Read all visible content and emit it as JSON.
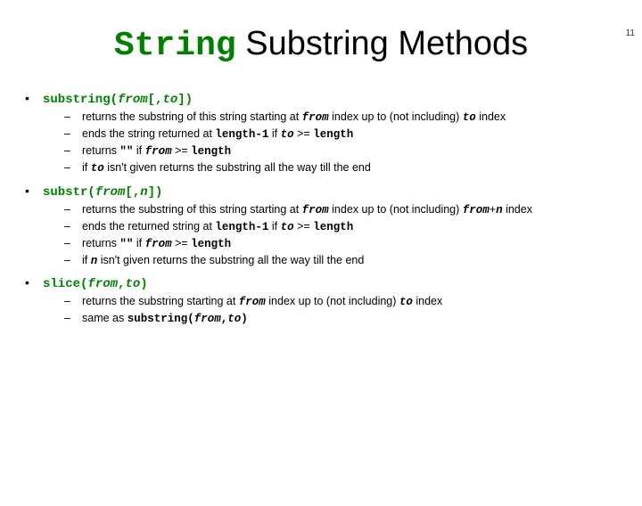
{
  "page_number": "11",
  "title": {
    "code_part": "String",
    "rest": " Substring Methods"
  },
  "methods": [
    {
      "sig_html": "substring(<span class='arg'>from</span>[,<span class='arg'>to</span>])",
      "items": [
        "returns the substring of this string starting at <span class='ci'>from</span> index up to (not including) <span class='ci'>to</span> index",
        "ends the string returned at <span class='c'>length-1</span> if <span class='ci'>to</span> &gt;= <span class='c'>length</span>",
        "returns <span class='c'>\"\"</span> if <span class='ci'>from</span> &gt;= <span class='c'>length</span>",
        "if <span class='ci'>to</span> isn't given returns the substring all the way till the end"
      ]
    },
    {
      "sig_html": "substr(<span class='arg'>from</span>[,<span class='arg'>n</span>])",
      "items": [
        "returns the substring of this string starting at <span class='ci'>from</span> index up to (not including) <span class='ci'>from</span>+<span class='ci'>n</span> index",
        "ends the returned string at <span class='c'>length-1</span> if <span class='ci'>to</span> &gt;= <span class='c'>length</span>",
        "returns <span class='c'>\"\"</span> if <span class='ci'>from</span> &gt;= <span class='c'>length</span>",
        "if <span class='ci'>n</span> isn't given returns the substring all the way till the end"
      ]
    },
    {
      "sig_html": "slice(<span class='arg'>from</span>,<span class='arg'>to</span>)",
      "items": [
        "returns the substring starting at <span class='ci'>from</span> index up to (not including) <span class='ci'>to</span> index",
        "same as <span class='c'>substring(<span class='ci'>from</span>,<span class='ci'>to</span>)</span>"
      ]
    }
  ]
}
